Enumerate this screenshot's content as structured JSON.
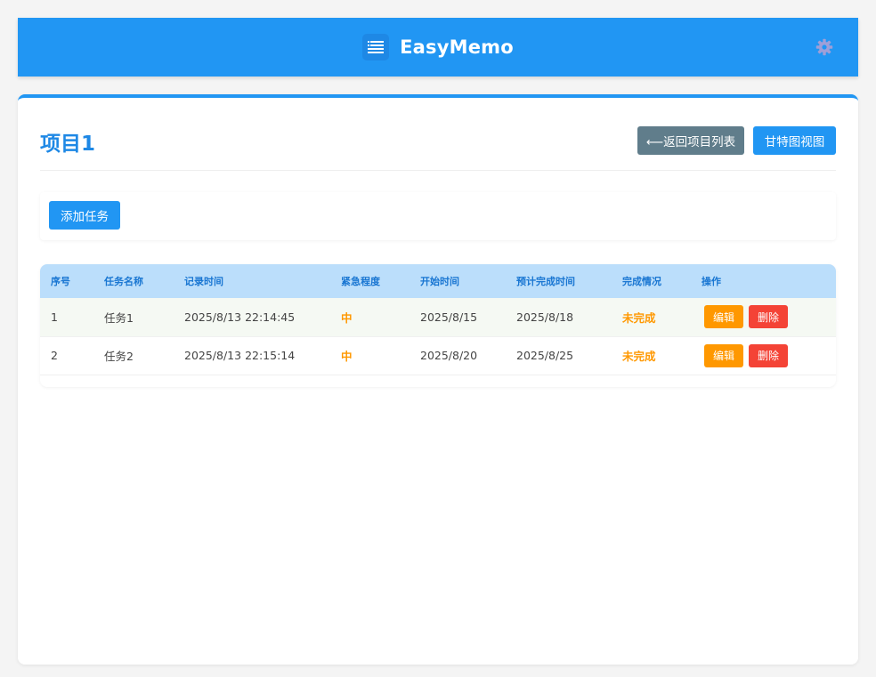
{
  "app": {
    "title": "EasyMemo",
    "icons": {
      "logo": "list-icon",
      "settings": "gear-icon"
    }
  },
  "project": {
    "title": "项目1",
    "back_label": "⟵返回项目列表",
    "gantt_label": "甘特图视图",
    "add_task_label": "添加任务"
  },
  "table": {
    "columns": [
      "序号",
      "任务名称",
      "记录时间",
      "紧急程度",
      "开始时间",
      "预计完成时间",
      "完成情况",
      "操作"
    ],
    "rows": [
      {
        "id": "1",
        "name": "任务1",
        "recorded": "2025/8/13 22:14:45",
        "urgency": "中",
        "start": "2025/8/15",
        "due": "2025/8/18",
        "status": "未完成",
        "edit": "编辑",
        "delete": "删除"
      },
      {
        "id": "2",
        "name": "任务2",
        "recorded": "2025/8/13 22:15:14",
        "urgency": "中",
        "start": "2025/8/20",
        "due": "2025/8/25",
        "status": "未完成",
        "edit": "编辑",
        "delete": "删除"
      }
    ]
  },
  "colors": {
    "primary": "#2196f3",
    "title_blue": "#1e88e5",
    "back_button": "#607d8b",
    "edit_button": "#ff9800",
    "delete_button": "#f44336",
    "header_row": "#bbdefb"
  }
}
